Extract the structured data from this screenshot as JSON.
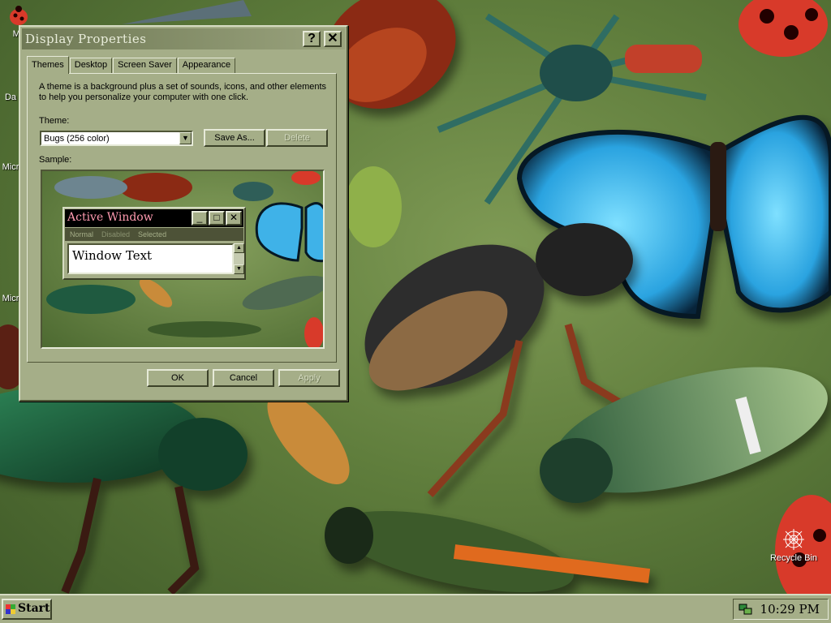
{
  "desktop": {
    "icons": [
      {
        "label": "My"
      },
      {
        "label": "Da"
      },
      {
        "label": "Micr"
      },
      {
        "label": "Micr"
      },
      {
        "label": "Recycle Bin"
      }
    ]
  },
  "dialog": {
    "title": "Display Properties",
    "help_glyph": "?",
    "close_glyph": "✕",
    "tabs": [
      "Themes",
      "Desktop",
      "Screen Saver",
      "Appearance"
    ],
    "description": "A theme is a background plus a set of sounds, icons, and other elements to help you personalize your computer with one click.",
    "theme_label": "Theme:",
    "theme_value": "Bugs (256 color)",
    "save_as": "Save As...",
    "delete": "Delete",
    "sample_label": "Sample:",
    "ok": "OK",
    "cancel": "Cancel",
    "apply": "Apply"
  },
  "sample_window": {
    "title": "Active Window",
    "menu": [
      "Normal",
      "Disabled",
      "Selected"
    ],
    "text": "Window Text"
  },
  "taskbar": {
    "start_label": "Start",
    "clock": "10:29 PM"
  },
  "colors": {
    "chrome": "#a5ae88",
    "title_text": "#e9eddb",
    "active_title": "#ff9ab0"
  }
}
